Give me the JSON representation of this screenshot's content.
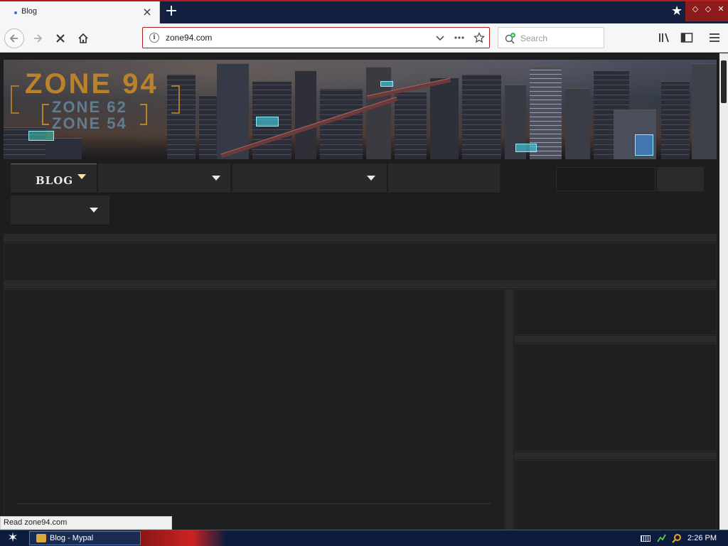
{
  "browser": {
    "tab": {
      "title": "Blog",
      "close": "×"
    },
    "new_tab": "+",
    "url": "zone94.com",
    "search_placeholder": "Search",
    "window_controls": [
      "◇",
      "◇",
      "✕"
    ]
  },
  "site": {
    "logo_main": "ZONE 94",
    "logo_sub": [
      "ZONE 62",
      "ZONE 54"
    ],
    "nav": [
      {
        "label": "BLOG",
        "active": true,
        "has_dropdown": true
      },
      {
        "label": "",
        "has_dropdown": true
      },
      {
        "label": "",
        "has_dropdown": true
      },
      {
        "label": "",
        "has_dropdown": false
      },
      {
        "label": "",
        "has_dropdown": true
      }
    ]
  },
  "status_text": "Read zone94.com",
  "taskbar": {
    "task_label": "Blog - Mypal",
    "clock": "2:26 PM"
  },
  "colors": {
    "page_bg": "#1d1d20",
    "tabbar": "#13203f",
    "accent_red": "#b51d1d",
    "logo_gold": "#b9822b"
  }
}
